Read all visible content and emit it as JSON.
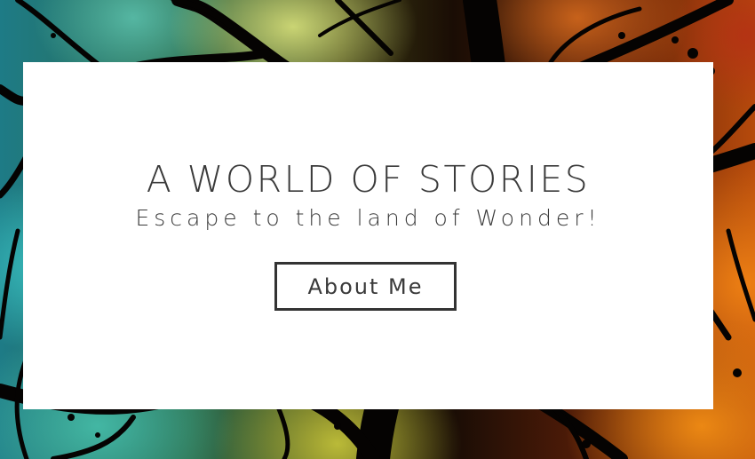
{
  "hero": {
    "title": "A WORLD OF STORIES",
    "subtitle": "Escape to the land of Wonder!",
    "button_label": "About Me",
    "background_description_colors": {
      "teal": "#1e7b86",
      "yellow_green": "#c8d46c",
      "orange": "#f08c14",
      "dark_red": "#5a1e08",
      "silhouette": "#050302"
    }
  },
  "card": {
    "background": "#ffffff",
    "text_color": "#3a3a3a",
    "button_border": "#333333"
  }
}
